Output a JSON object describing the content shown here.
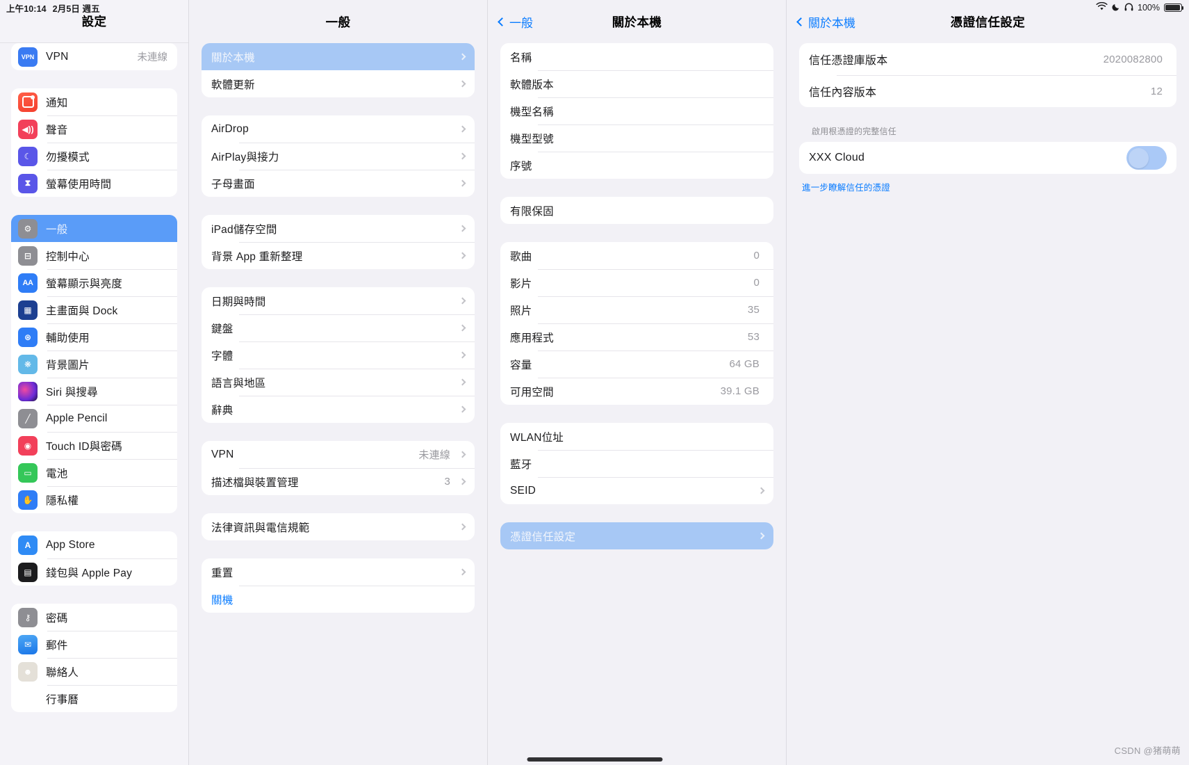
{
  "statusbar": {
    "time": "上午10:14",
    "date": "2月5日 週五",
    "wifi_icon": "wifi-icon",
    "moon_icon": "moon-icon",
    "headphone_icon": "headphones-icon",
    "battery_percent": "100%",
    "battery_icon": "battery-full-icon"
  },
  "sidebar": {
    "title": "設定",
    "groups": [
      {
        "items": [
          {
            "icon": "vpn-icon",
            "icon_class": "i-vpn",
            "glyph": "VPN",
            "label": "VPN",
            "value": "未連線"
          }
        ]
      },
      {
        "items": [
          {
            "icon": "notifications-icon",
            "icon_class": "i-notif",
            "glyph": "",
            "label": "通知",
            "value": ""
          },
          {
            "icon": "sound-icon",
            "icon_class": "i-sound",
            "glyph": "◀))",
            "label": "聲音",
            "value": ""
          },
          {
            "icon": "moon-icon",
            "icon_class": "i-dnd",
            "glyph": "☾",
            "label": "勿擾模式",
            "value": ""
          },
          {
            "icon": "hourglass-icon",
            "icon_class": "i-screen",
            "glyph": "⧗",
            "label": "螢幕使用時間",
            "value": ""
          }
        ]
      },
      {
        "items": [
          {
            "icon": "gear-icon",
            "icon_class": "i-gear",
            "glyph": "⚙",
            "label": "一般",
            "value": "",
            "selected": true
          },
          {
            "icon": "control-center-icon",
            "icon_class": "i-cc",
            "glyph": "⊟",
            "label": "控制中心",
            "value": ""
          },
          {
            "icon": "display-brightness-icon",
            "icon_class": "i-aa",
            "glyph": "AA",
            "label": "螢幕顯示與亮度",
            "value": ""
          },
          {
            "icon": "home-dock-icon",
            "icon_class": "i-dock",
            "glyph": "▦",
            "label": "主畫面與 Dock",
            "value": ""
          },
          {
            "icon": "accessibility-icon",
            "icon_class": "i-access",
            "glyph": "⊛",
            "label": "輔助使用",
            "value": ""
          },
          {
            "icon": "wallpaper-icon",
            "icon_class": "i-wall",
            "glyph": "❋",
            "label": "背景圖片",
            "value": ""
          },
          {
            "icon": "siri-icon",
            "icon_class": "i-siri",
            "glyph": "",
            "label": "Siri 與搜尋",
            "value": ""
          },
          {
            "icon": "apple-pencil-icon",
            "icon_class": "i-pencil",
            "glyph": "╱",
            "label": "Apple Pencil",
            "value": ""
          },
          {
            "icon": "touch-id-icon",
            "icon_class": "i-touch",
            "glyph": "◉",
            "label": "Touch ID與密碼",
            "value": ""
          },
          {
            "icon": "battery-icon",
            "icon_class": "i-batt",
            "glyph": "▭",
            "label": "電池",
            "value": ""
          },
          {
            "icon": "privacy-hand-icon",
            "icon_class": "i-priv",
            "glyph": "✋",
            "label": "隱私權",
            "value": ""
          }
        ]
      },
      {
        "items": [
          {
            "icon": "app-store-icon",
            "icon_class": "i-appstore",
            "glyph": "A",
            "label": "App Store",
            "value": ""
          },
          {
            "icon": "wallet-icon",
            "icon_class": "i-wallet",
            "glyph": "▤",
            "label": "錢包與 Apple Pay",
            "value": ""
          }
        ]
      },
      {
        "items": [
          {
            "icon": "key-icon",
            "icon_class": "i-pass",
            "glyph": "⚷",
            "label": "密碼",
            "value": ""
          },
          {
            "icon": "mail-icon",
            "icon_class": "i-mail",
            "glyph": "✉",
            "label": "郵件",
            "value": ""
          },
          {
            "icon": "contacts-icon",
            "icon_class": "i-contacts",
            "glyph": "☻",
            "label": "聯絡人",
            "value": ""
          },
          {
            "icon": "calendar-icon",
            "icon_class": "i-cal",
            "glyph": "▤",
            "label": "行事曆",
            "value": ""
          }
        ]
      }
    ]
  },
  "general": {
    "title": "一般",
    "groups": [
      {
        "items": [
          {
            "label": "關於本機",
            "value": "",
            "selected": true,
            "chevron": true
          },
          {
            "label": "軟體更新",
            "value": "",
            "chevron": true
          }
        ]
      },
      {
        "items": [
          {
            "label": "AirDrop",
            "value": "",
            "chevron": true
          },
          {
            "label": "AirPlay與接力",
            "value": "",
            "chevron": true
          },
          {
            "label": "子母畫面",
            "value": "",
            "chevron": true
          }
        ]
      },
      {
        "items": [
          {
            "label": "iPad儲存空間",
            "value": "",
            "chevron": true
          },
          {
            "label": "背景 App 重新整理",
            "value": "",
            "chevron": true
          }
        ]
      },
      {
        "items": [
          {
            "label": "日期與時間",
            "value": "",
            "chevron": true
          },
          {
            "label": "鍵盤",
            "value": "",
            "chevron": true
          },
          {
            "label": "字體",
            "value": "",
            "chevron": true
          },
          {
            "label": "語言與地區",
            "value": "",
            "chevron": true
          },
          {
            "label": "辭典",
            "value": "",
            "chevron": true
          }
        ]
      },
      {
        "items": [
          {
            "label": "VPN",
            "value": "未連線",
            "chevron": true
          },
          {
            "label": "描述檔與裝置管理",
            "value": "3",
            "chevron": true
          }
        ]
      },
      {
        "items": [
          {
            "label": "法律資訊與電信規範",
            "value": "",
            "chevron": true
          }
        ]
      },
      {
        "items": [
          {
            "label": "重置",
            "value": "",
            "chevron": true
          },
          {
            "label": "關機",
            "value": "",
            "link": true
          }
        ]
      }
    ]
  },
  "about": {
    "title": "關於本機",
    "back_label": "一般",
    "groups": [
      {
        "items": [
          {
            "label": "名稱",
            "value": ""
          },
          {
            "label": "軟體版本",
            "value": ""
          },
          {
            "label": "機型名稱",
            "value": ""
          },
          {
            "label": "機型型號",
            "value": ""
          },
          {
            "label": "序號",
            "value": ""
          }
        ]
      },
      {
        "items": [
          {
            "label": "有限保固",
            "value": ""
          }
        ]
      },
      {
        "items": [
          {
            "label": "歌曲",
            "value": "0"
          },
          {
            "label": "影片",
            "value": "0"
          },
          {
            "label": "照片",
            "value": "35"
          },
          {
            "label": "應用程式",
            "value": "53"
          },
          {
            "label": "容量",
            "value": "64 GB"
          },
          {
            "label": "可用空間",
            "value": "39.1 GB"
          }
        ]
      },
      {
        "items": [
          {
            "label": "WLAN位址",
            "value": ""
          },
          {
            "label": "藍牙",
            "value": ""
          },
          {
            "label": "SEID",
            "value": "",
            "chevron": true
          }
        ]
      },
      {
        "items": [
          {
            "label": "憑證信任設定",
            "value": "",
            "selected": true,
            "chevron": true
          }
        ]
      }
    ]
  },
  "cert": {
    "title": "憑證信任設定",
    "back_label": "關於本機",
    "version_rows": [
      {
        "label": "信任憑證庫版本",
        "value": "2020082800"
      },
      {
        "label": "信任內容版本",
        "value": "12"
      }
    ],
    "section_footer": "啟用根憑證的完整信任",
    "trust_row": {
      "label": "XXX Cloud",
      "toggle_on": false
    },
    "learn_more": "進一步瞭解信任的憑證"
  },
  "watermark": "CSDN @猪萌萌"
}
